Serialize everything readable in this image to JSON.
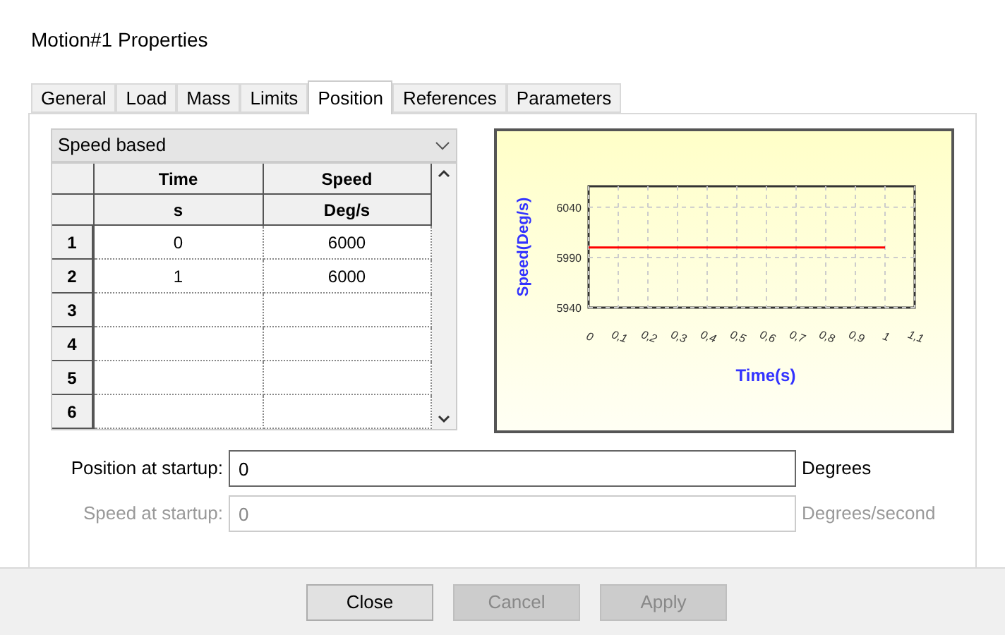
{
  "window": {
    "title": "Motion#1 Properties"
  },
  "tabs": [
    {
      "label": "General",
      "selected": false
    },
    {
      "label": "Load",
      "selected": false
    },
    {
      "label": "Mass",
      "selected": false
    },
    {
      "label": "Limits",
      "selected": false
    },
    {
      "label": "Position",
      "selected": true
    },
    {
      "label": "References",
      "selected": false
    },
    {
      "label": "Parameters",
      "selected": false
    }
  ],
  "mode_dropdown": {
    "value": "Speed based"
  },
  "table": {
    "columns": [
      {
        "name": "Time",
        "unit": "s"
      },
      {
        "name": "Speed",
        "unit": "Deg/s"
      }
    ],
    "rows": [
      {
        "number": "1",
        "cells": [
          "0",
          "6000"
        ]
      },
      {
        "number": "2",
        "cells": [
          "1",
          "6000"
        ]
      },
      {
        "number": "3",
        "cells": []
      },
      {
        "number": "4",
        "cells": []
      },
      {
        "number": "5",
        "cells": []
      },
      {
        "number": "6",
        "cells": []
      }
    ]
  },
  "chart_data": {
    "type": "line",
    "xlabel": "Time(s)",
    "ylabel": "Speed(Deg/s)",
    "x": [
      0,
      1
    ],
    "grid": true,
    "series": [
      {
        "color": "#ff0000",
        "values": [
          6000,
          6000
        ]
      }
    ],
    "xlim": [
      0,
      1.1
    ],
    "ylim": [
      5940,
      6061
    ],
    "xticks": [
      0,
      {
        "value": 0.1,
        "label": "0,1"
      },
      {
        "value": 0.2,
        "label": "0,2"
      },
      {
        "value": 0.3,
        "label": "0,3"
      },
      {
        "value": 0.4,
        "label": "0,4"
      },
      {
        "value": 0.5,
        "label": "0,5"
      },
      {
        "value": 0.6,
        "label": "0,6"
      },
      {
        "value": 0.7,
        "label": "0,7"
      },
      {
        "value": 0.8,
        "label": "0,8"
      },
      {
        "value": 0.9,
        "label": "0,9"
      },
      1,
      {
        "value": 1.1,
        "label": "1,1"
      }
    ],
    "yticks": [
      5940,
      5990,
      6040
    ]
  },
  "fields": [
    {
      "label": "Position at startup:",
      "value": "0",
      "unit": "Degrees",
      "disabled": false
    },
    {
      "label": "Speed at startup:",
      "value": "0",
      "unit": "Degrees/second",
      "disabled": true
    }
  ],
  "buttons": [
    {
      "label": "Close",
      "disabled": false
    },
    {
      "label": "Cancel",
      "disabled": true
    },
    {
      "label": "Apply",
      "disabled": true
    }
  ]
}
